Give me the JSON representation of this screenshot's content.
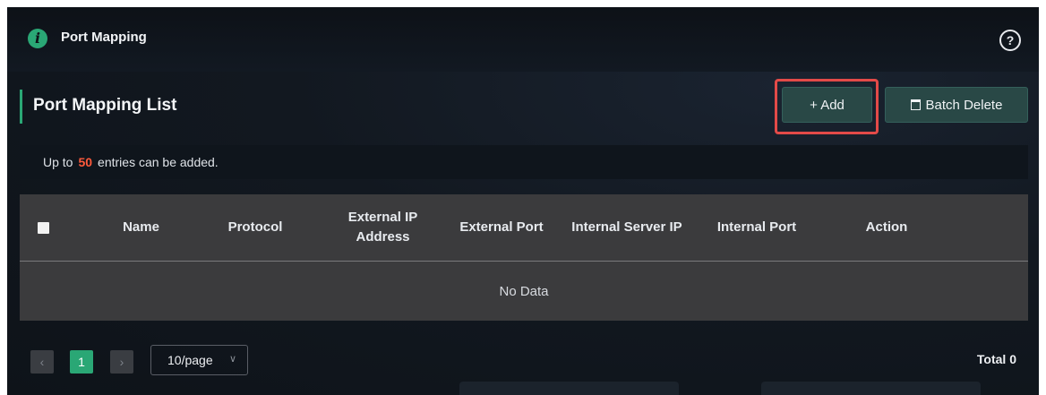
{
  "header": {
    "title": "Port Mapping",
    "info_icon_glyph": "i",
    "help_icon_glyph": "?"
  },
  "section": {
    "title": "Port Mapping List"
  },
  "toolbar": {
    "add_label": "+ Add",
    "batch_delete_label": "Batch Delete"
  },
  "notice": {
    "prefix": "Up to",
    "count": "50",
    "suffix": "entries can be added."
  },
  "table": {
    "columns": [
      "Name",
      "Protocol",
      "External IP Address",
      "External Port",
      "Internal Server IP",
      "Internal Port",
      "Action"
    ],
    "empty_text": "No Data"
  },
  "pagination": {
    "prev": "‹",
    "current_page": "1",
    "next": "›",
    "page_size": "10/page",
    "total": "Total 0"
  },
  "colors": {
    "accent": "#2aa775",
    "highlight": "#e34a48",
    "count": "#ff5a3c"
  }
}
